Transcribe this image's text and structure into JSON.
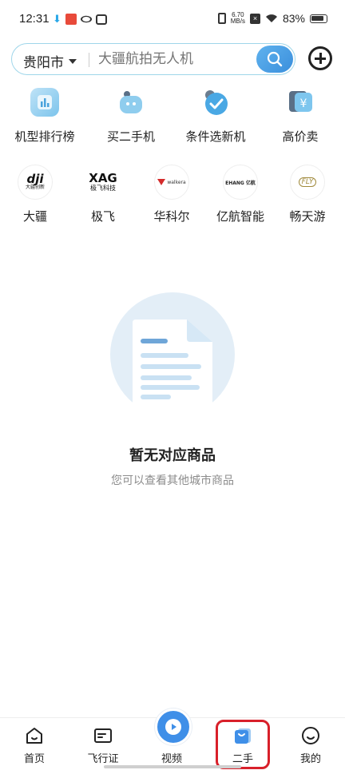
{
  "status_bar": {
    "time": "12:31",
    "speed_value": "6.70",
    "speed_unit": "MB/s",
    "battery": "83%"
  },
  "search": {
    "city": "贵阳市",
    "placeholder": "大疆航拍无人机"
  },
  "quick_links": [
    {
      "label": "机型排行榜",
      "icon": "ranking-chart-icon"
    },
    {
      "label": "买二手机",
      "icon": "robot-bag-icon"
    },
    {
      "label": "条件选新机",
      "icon": "check-badge-icon"
    },
    {
      "label": "高价卖",
      "icon": "yen-tag-icon"
    }
  ],
  "brands": [
    {
      "label": "大疆",
      "logo_main": "dji",
      "logo_sub": "大疆创新"
    },
    {
      "label": "极飞",
      "logo_main": "XAG",
      "logo_sub": "极飞科技"
    },
    {
      "label": "华科尔",
      "logo_main": "walkera",
      "logo_sub": ""
    },
    {
      "label": "亿航智能",
      "logo_main": "EHANG 亿航",
      "logo_sub": ""
    },
    {
      "label": "畅天游",
      "logo_main": "FLY",
      "logo_sub": ""
    }
  ],
  "empty_state": {
    "title": "暂无对应商品",
    "subtitle": "您可以查看其他城市商品"
  },
  "tabs": [
    {
      "label": "首页",
      "icon": "home-icon"
    },
    {
      "label": "飞行证",
      "icon": "license-card-icon"
    },
    {
      "label": "视频",
      "icon": "play-icon"
    },
    {
      "label": "二手",
      "icon": "shopping-bag-icon",
      "active": true
    },
    {
      "label": "我的",
      "icon": "smiley-profile-icon"
    }
  ],
  "colors": {
    "accent": "#3f8fe8",
    "highlight_box": "#d8202a"
  }
}
